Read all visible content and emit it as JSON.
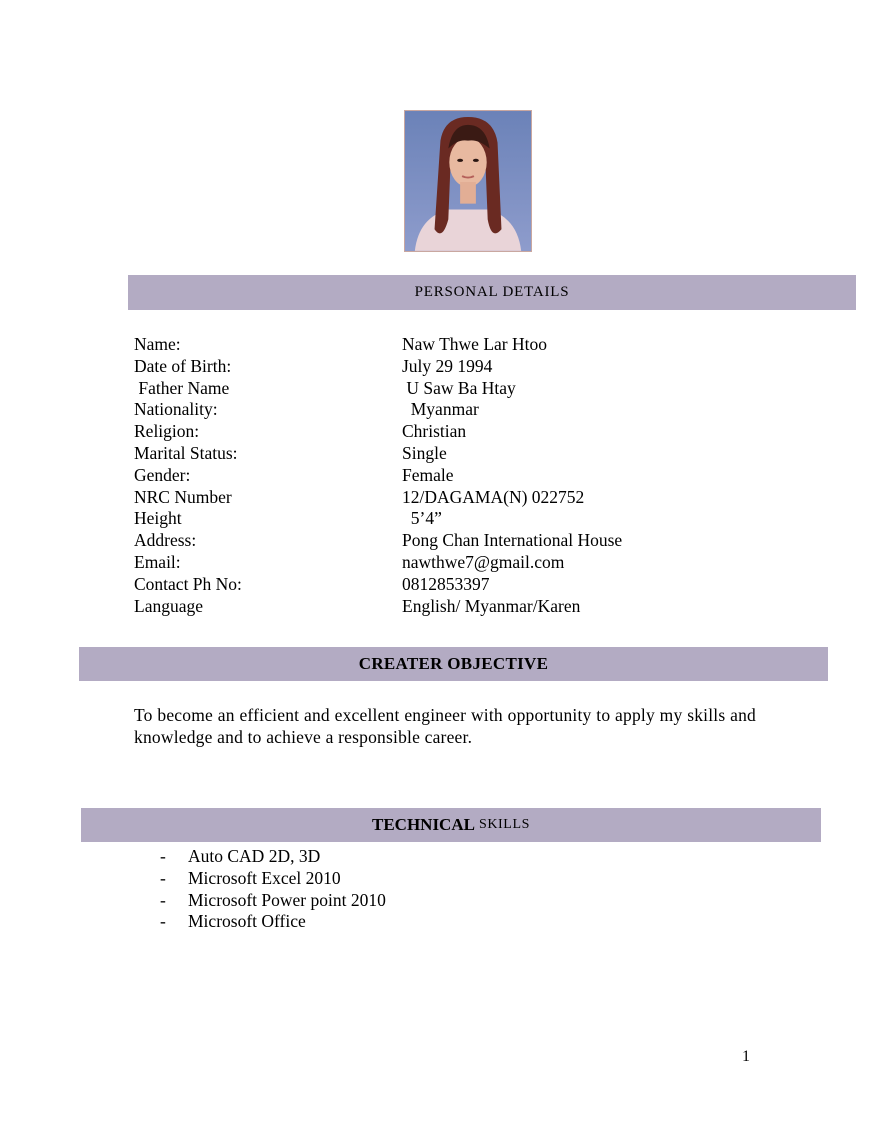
{
  "photo": {
    "alt": "profile-photo"
  },
  "personal_details": {
    "heading": "PERSONAL DETAILS",
    "rows": [
      {
        "label": "Name:",
        "value": "Naw Thwe Lar Htoo"
      },
      {
        "label": "Date of Birth:",
        "value": "July 29 1994"
      },
      {
        "label": " Father Name",
        "value": " U Saw Ba Htay"
      },
      {
        "label": "Nationality:",
        "value": "  Myanmar"
      },
      {
        "label": "Religion:",
        "value": "Christian"
      },
      {
        "label": "Marital Status:",
        "value": "Single"
      },
      {
        "label": "Gender:",
        "value": "Female"
      },
      {
        "label": "NRC Number",
        "value": "12/DAGAMA(N) 022752"
      },
      {
        "label": "Height",
        "value": "  5’4”"
      },
      {
        "label": "Address:",
        "value": "Pong Chan International House"
      },
      {
        "label": "Email:",
        "value": "nawthwe7@gmail.com"
      },
      {
        "label": "Contact Ph No:",
        "value": "0812853397"
      },
      {
        "label": "Language",
        "value": "English/ Myanmar/Karen"
      }
    ]
  },
  "objective": {
    "heading": "CREATER OBJECTIVE",
    "text": "To become an efficient and excellent engineer with opportunity to apply my skills and knowledge and to achieve a responsible career."
  },
  "skills": {
    "heading_bold": "TECHNICAL",
    "heading_small": "SKILLS",
    "bullet": "-",
    "items": [
      "Auto CAD 2D, 3D",
      "Microsoft Excel 2010",
      "Microsoft Power point 2010",
      "Microsoft Office"
    ]
  },
  "page_number": "1"
}
